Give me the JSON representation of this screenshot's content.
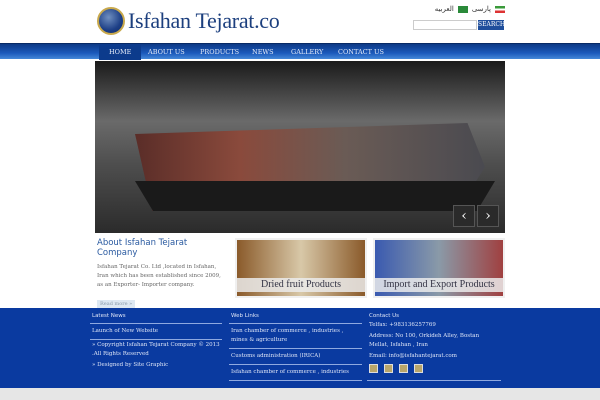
{
  "header": {
    "brand": "Isfahan Tejarat.co",
    "lang_farsi": "پارسی",
    "lang_arabic": "العربیه",
    "search_placeholder": "",
    "search_button": "SEARCH"
  },
  "nav": [
    "HOME",
    "ABOUT US",
    "PRODUCTS",
    "NEWS",
    "GALLERY",
    "CONTACT US"
  ],
  "slider": {
    "prev": "‹",
    "next": "›"
  },
  "about": {
    "title": "About Isfahan Tejarat Company",
    "text": "Isfahan Tejarat Co. Ltd ,located in Isfahan, Iran which has been established since 2009, as an Exporter- Importer company.",
    "more": "Read more »"
  },
  "products": [
    {
      "caption": "Dried fruit  Products"
    },
    {
      "caption": "Import and Export Products"
    }
  ],
  "footer": {
    "news": {
      "title": "Latest News",
      "items": [
        "Launch of New Website"
      ],
      "copyright": "» Copyright Isfahan Tejarat Company © 2013 .All Rights Reserved",
      "designed": "» Designed by Site Graphic"
    },
    "links": {
      "title": "Web Links",
      "items": [
        "Iran chamber of commerce , industries , mines & agriculture",
        "Customs administration (IRICA)",
        "Isfahan chamber of commerce , industries"
      ]
    },
    "contact": {
      "title": "Contact Us",
      "tel": "Telfax: +983136257769",
      "address": "Address: No 100, Orkideh Alley, Bostan Mellat, Isfahan , Iran",
      "email": "Email: info@isfahantejarat.com"
    }
  }
}
